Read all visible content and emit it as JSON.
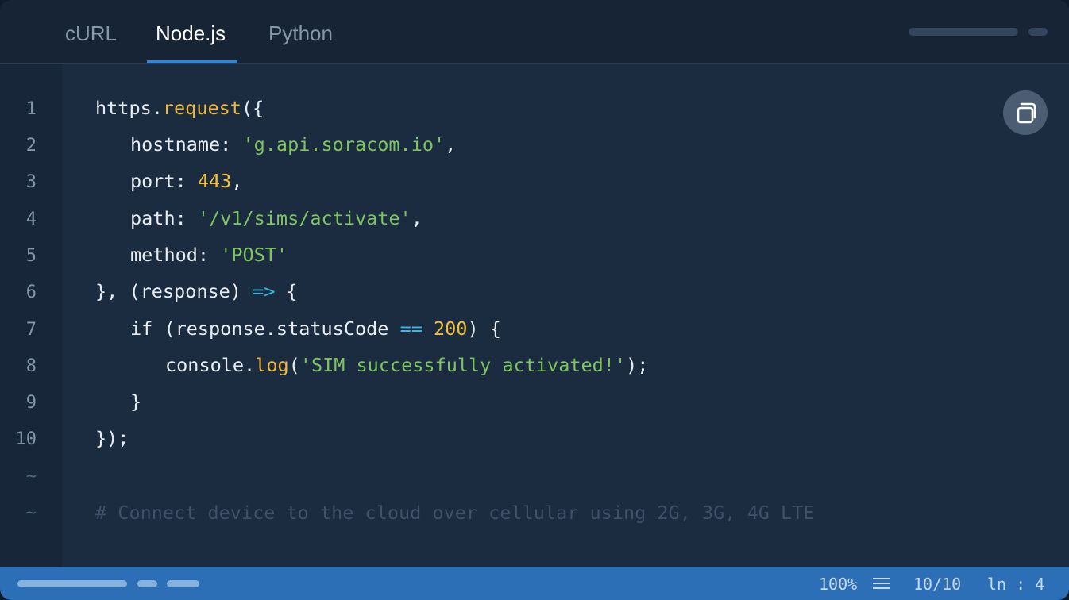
{
  "tabs": [
    {
      "label": "cURL",
      "active": false
    },
    {
      "label": "Node.js",
      "active": true
    },
    {
      "label": "Python",
      "active": false
    }
  ],
  "gutter": {
    "line_numbers": [
      "1",
      "2",
      "3",
      "4",
      "5",
      "6",
      "7",
      "8",
      "9",
      "10"
    ],
    "empty_marker": "~"
  },
  "code": {
    "lines": [
      [
        {
          "t": "https.",
          "k": "plain"
        },
        {
          "t": "request",
          "k": "fn"
        },
        {
          "t": "({",
          "k": "plain"
        }
      ],
      [
        {
          "t": "hostname: ",
          "k": "plain"
        },
        {
          "t": "'g.api.soracom.io'",
          "k": "str"
        },
        {
          "t": ",",
          "k": "plain"
        }
      ],
      [
        {
          "t": "port: ",
          "k": "plain"
        },
        {
          "t": "443",
          "k": "num"
        },
        {
          "t": ",",
          "k": "plain"
        }
      ],
      [
        {
          "t": "path: ",
          "k": "plain"
        },
        {
          "t": "'/v1/sims/activate'",
          "k": "str"
        },
        {
          "t": ",",
          "k": "plain"
        }
      ],
      [
        {
          "t": "method: ",
          "k": "plain"
        },
        {
          "t": "'POST'",
          "k": "str"
        }
      ],
      [
        {
          "t": "}, (response) ",
          "k": "plain"
        },
        {
          "t": "=>",
          "k": "op"
        },
        {
          "t": " {",
          "k": "plain"
        }
      ],
      [
        {
          "t": "if (response.statusCode ",
          "k": "plain"
        },
        {
          "t": "==",
          "k": "op"
        },
        {
          "t": " ",
          "k": "plain"
        },
        {
          "t": "200",
          "k": "num"
        },
        {
          "t": ") {",
          "k": "plain"
        }
      ],
      [
        {
          "t": "console.",
          "k": "plain"
        },
        {
          "t": "log",
          "k": "fn"
        },
        {
          "t": "(",
          "k": "plain"
        },
        {
          "t": "'SIM successfully activated!'",
          "k": "str"
        },
        {
          "t": ");",
          "k": "plain"
        }
      ],
      [
        {
          "t": "}",
          "k": "plain"
        }
      ],
      [
        {
          "t": "});",
          "k": "plain"
        }
      ]
    ],
    "comment": "# Connect device to the cloud over cellular using 2G, 3G, 4G LTE"
  },
  "copy_button": {
    "icon": "copy-icon"
  },
  "status_bar": {
    "zoom": "100%",
    "menu_icon": "menu-icon",
    "lines": "10/10",
    "position": "ln : 4"
  },
  "colors": {
    "background": "#1b2b40",
    "tab_active_underline": "#2f86d6",
    "function": "#f2b83a",
    "string": "#7cc45e",
    "number": "#f2c13a",
    "operator": "#3bb6e0",
    "status_bar": "#2d6fb6"
  }
}
